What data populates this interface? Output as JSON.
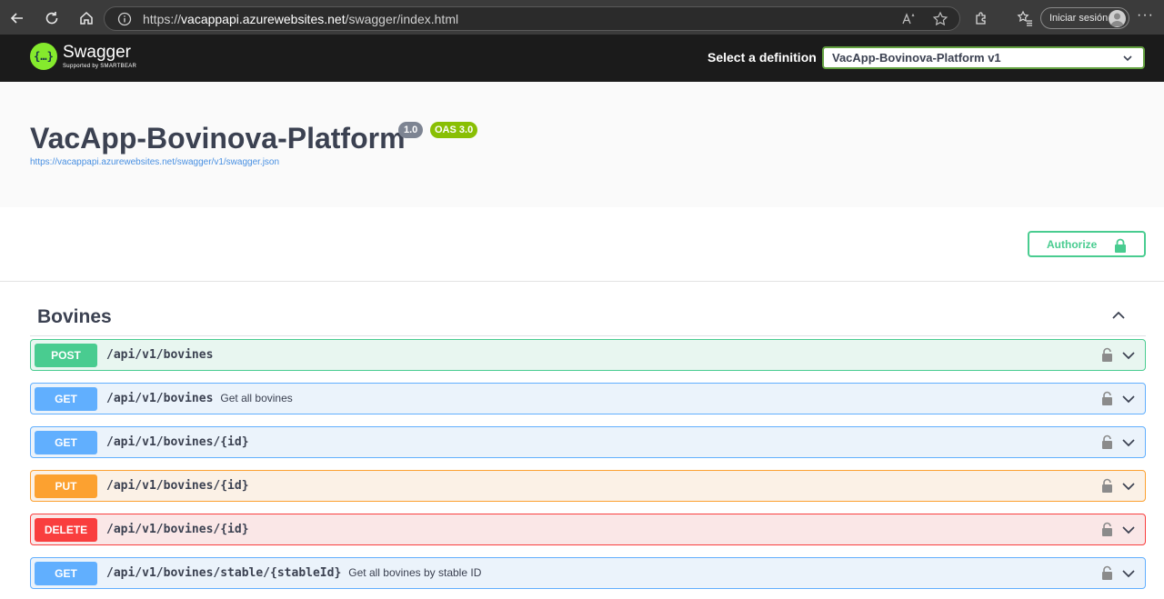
{
  "browser": {
    "url_prefix": "https://",
    "url_host": "vacappapi.azurewebsites.net",
    "url_path": "/swagger/index.html",
    "signin_label": "Iniciar sesión"
  },
  "topbar": {
    "logo_word": "Swagger",
    "logo_sub": "Supported by SMARTBEAR",
    "logo_glyph": "{…}",
    "definition_label": "Select a definition",
    "definition_selected": "VacApp-Bovinova-Platform v1"
  },
  "info": {
    "title": "VacApp-Bovinova-Platform",
    "version": "1.0",
    "oas": "OAS 3.0",
    "spec_url": "https://vacappapi.azurewebsites.net/swagger/v1/swagger.json"
  },
  "schemes": {
    "authorize_label": "Authorize"
  },
  "tag": {
    "name": "Bovines"
  },
  "operations": [
    {
      "method": "POST",
      "path": "/api/v1/bovines",
      "summary": ""
    },
    {
      "method": "GET",
      "path": "/api/v1/bovines",
      "summary": "Get all bovines"
    },
    {
      "method": "GET",
      "path": "/api/v1/bovines/{id}",
      "summary": ""
    },
    {
      "method": "PUT",
      "path": "/api/v1/bovines/{id}",
      "summary": ""
    },
    {
      "method": "DELETE",
      "path": "/api/v1/bovines/{id}",
      "summary": ""
    },
    {
      "method": "GET",
      "path": "/api/v1/bovines/stable/{stableId}",
      "summary": "Get all bovines by stable ID"
    }
  ],
  "colors": {
    "post": "#49cc90",
    "get": "#61affe",
    "put": "#fca130",
    "delete": "#f93e3e",
    "swagger_green": "#85ea2d"
  },
  "icons": [
    "back-arrow-icon",
    "refresh-icon",
    "home-icon",
    "info-icon",
    "read-aloud-icon",
    "favorite-star-icon",
    "extensions-icon",
    "favorites-icon",
    "more-icon",
    "lock-icon",
    "chevron-up-icon",
    "chevron-down-icon"
  ]
}
